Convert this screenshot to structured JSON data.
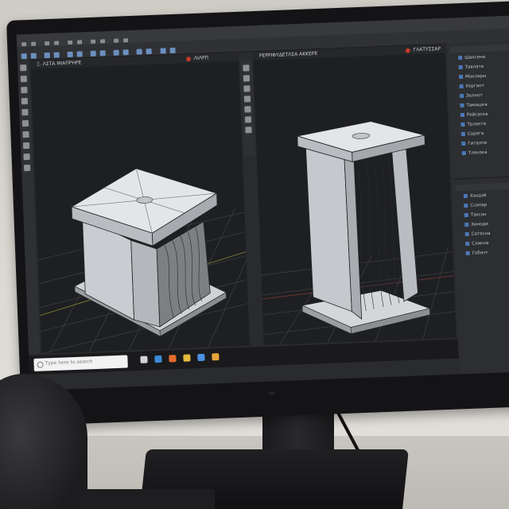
{
  "viewports": {
    "left": {
      "title": "Ξ. ΛΣΤΑ ΜΙΑΠΡΗΡΕ",
      "label": "ΛΙΛΡΠ"
    },
    "right": {
      "title": "ΡΕΡΡΙΦΥΔΕΤΛΣΑ ΑΚΚΕΡΕ",
      "label": "ΓΛΑΤΥΣΣΑΡ"
    }
  },
  "panel": {
    "items": [
      "Шаксена",
      "Тавлата",
      "Моклары",
      "Уоргант",
      "Зелнот",
      "Тамишка",
      "Рейсаска",
      "Трлекта",
      "Сорега",
      "Гиталпе",
      "Тлекока"
    ],
    "items2": [
      "Хахдзй",
      "Ссипар",
      "Тэксон",
      "Хиноди",
      "Сатесна",
      "Сликна",
      "Гобачт"
    ]
  },
  "taskbar": {
    "search_placeholder": "Туре here to search"
  },
  "colors": {
    "ui_dark": "#2a2b2e",
    "accent_blue": "#4a78b8",
    "grid": "#3b3c40",
    "model_fill": "#d7d9dc"
  }
}
